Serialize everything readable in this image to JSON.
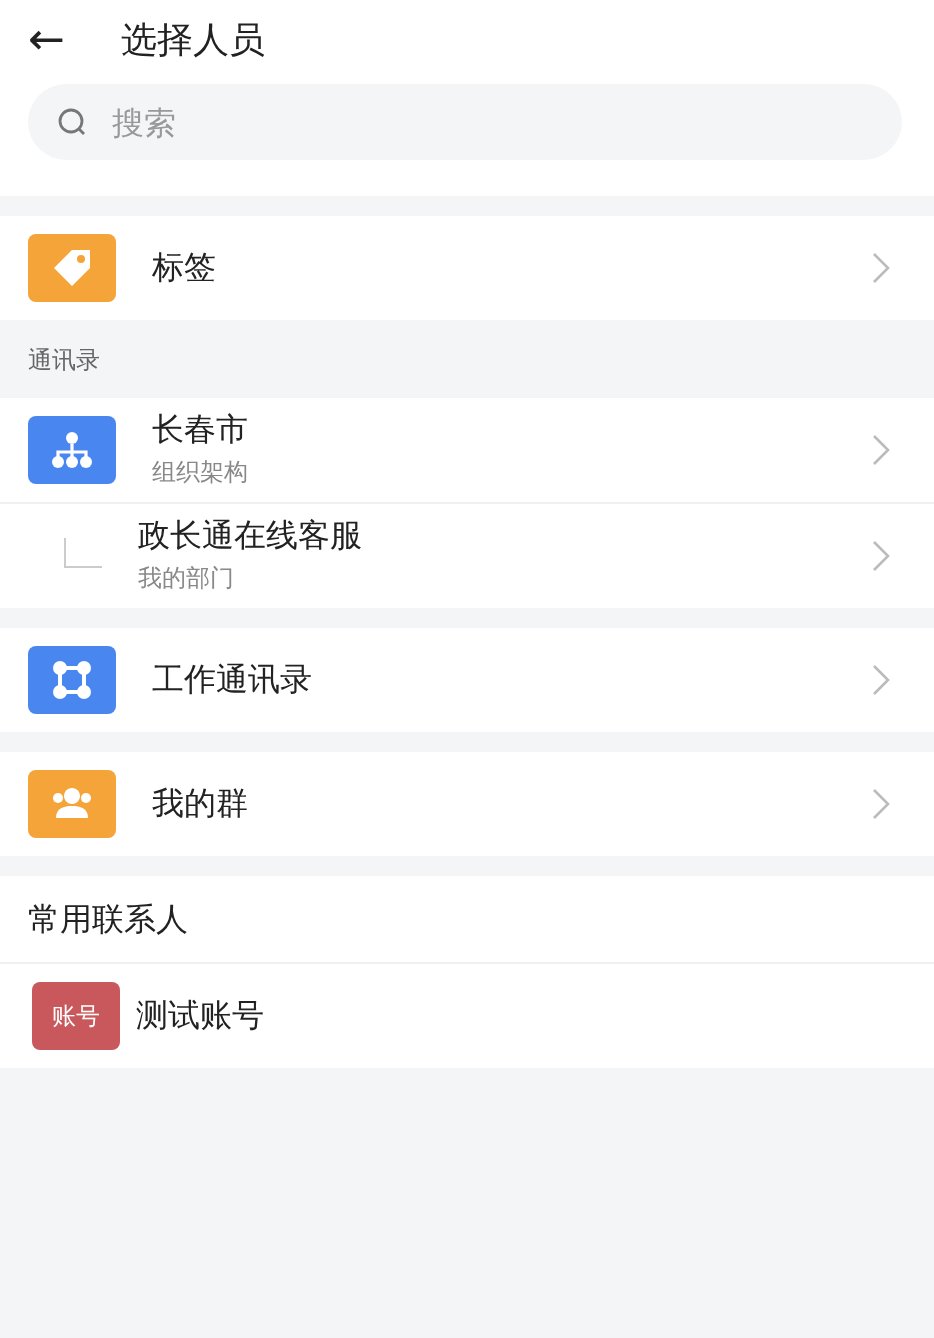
{
  "header": {
    "back": "←",
    "title": "选择人员"
  },
  "search": {
    "placeholder": "搜索"
  },
  "groups": [
    {
      "items": [
        {
          "kind": "tag",
          "color": "#f5a43a",
          "title": "标签"
        }
      ]
    },
    {
      "label": "通讯录",
      "items": [
        {
          "kind": "org",
          "color": "#4a86f0",
          "title": "长春市",
          "subtitle": "组织架构"
        },
        {
          "kind": "branch",
          "title": "政长通在线客服",
          "subtitle": "我的部门"
        }
      ]
    },
    {
      "items": [
        {
          "kind": "network",
          "color": "#4a86f0",
          "title": "工作通讯录"
        }
      ]
    },
    {
      "items": [
        {
          "kind": "people",
          "color": "#f5a43a",
          "title": "我的群"
        }
      ]
    }
  ],
  "frequent": {
    "title": "常用联系人",
    "contacts": [
      {
        "avatar": "账号",
        "color": "#c9585c",
        "name": "测试账号"
      }
    ]
  }
}
